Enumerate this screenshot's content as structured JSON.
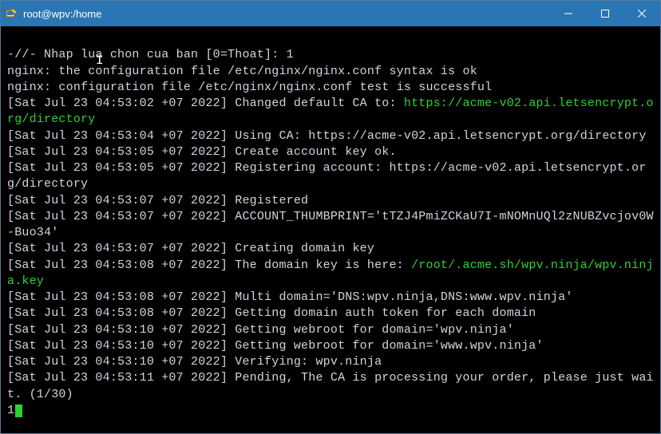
{
  "window": {
    "title": "root@wpv:/home"
  },
  "terminal": {
    "prompt_line": "-//- Nhap lua chon cua ban [0=Thoat]: 1",
    "nginx1": "nginx: the configuration file /etc/nginx/nginx.conf syntax is ok",
    "nginx2": "nginx: configuration file /etc/nginx/nginx.conf test is successful",
    "l1_ts": "[Sat Jul 23 04:53:02 +07 2022]",
    "l1_msg": " Changed default CA to: ",
    "l1_url": "https://acme-v02.api.letsencrypt.org/directory",
    "l2_ts": "[Sat Jul 23 04:53:04 +07 2022]",
    "l2_msg": " Using CA: https://acme-v02.api.letsencrypt.org/directory",
    "l3_ts": "[Sat Jul 23 04:53:05 +07 2022]",
    "l3_msg": " Create account key ok.",
    "l4_ts": "[Sat Jul 23 04:53:05 +07 2022]",
    "l4_msg": " Registering account: https://acme-v02.api.letsencrypt.org/directory",
    "l5_ts": "[Sat Jul 23 04:53:07 +07 2022]",
    "l5_msg": " Registered",
    "l6_ts": "[Sat Jul 23 04:53:07 +07 2022]",
    "l6_msg": " ACCOUNT_THUMBPRINT='tTZJ4PmiZCKaU7I-mNOMnUQl2zNUBZvcjov0W-Buo34'",
    "l7_ts": "[Sat Jul 23 04:53:07 +07 2022]",
    "l7_msg": " Creating domain key",
    "l8_ts": "[Sat Jul 23 04:53:08 +07 2022]",
    "l8_msg": " The domain key is here: ",
    "l8_path": "/root/.acme.sh/wpv.ninja/wpv.ninja.key",
    "l9_ts": "[Sat Jul 23 04:53:08 +07 2022]",
    "l9_msg": " Multi domain='DNS:wpv.ninja,DNS:www.wpv.ninja'",
    "l10_ts": "[Sat Jul 23 04:53:08 +07 2022]",
    "l10_msg": " Getting domain auth token for each domain",
    "l11_ts": "[Sat Jul 23 04:53:10 +07 2022]",
    "l11_msg": " Getting webroot for domain='wpv.ninja'",
    "l12_ts": "[Sat Jul 23 04:53:10 +07 2022]",
    "l12_msg": " Getting webroot for domain='www.wpv.ninja'",
    "l13_ts": "[Sat Jul 23 04:53:10 +07 2022]",
    "l13_msg": " Verifying: wpv.ninja",
    "l14_ts": "[Sat Jul 23 04:53:11 +07 2022]",
    "l14_msg": " Pending, The CA is processing your order, please just wait. (1/30)",
    "input_char": "1"
  }
}
